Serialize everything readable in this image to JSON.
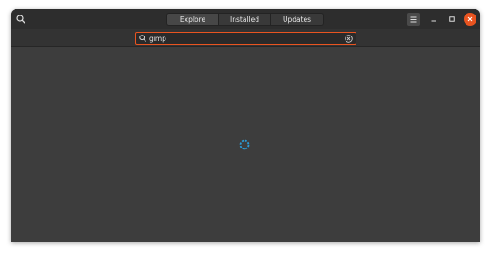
{
  "header": {
    "tabs": [
      {
        "label": "Explore",
        "active": true
      },
      {
        "label": "Installed",
        "active": false
      },
      {
        "label": "Updates",
        "active": false
      }
    ]
  },
  "search": {
    "value": "gimp"
  },
  "content": {
    "state": "loading"
  },
  "colors": {
    "accent": "#e95420",
    "spinner": "#2b9bd6",
    "background": "#3d3d3d",
    "headerbar": "#2d2d2d"
  },
  "icons": [
    "search-icon",
    "menu-icon",
    "minimize-icon",
    "maximize-icon",
    "close-icon",
    "clear-icon",
    "spinner-icon"
  ]
}
